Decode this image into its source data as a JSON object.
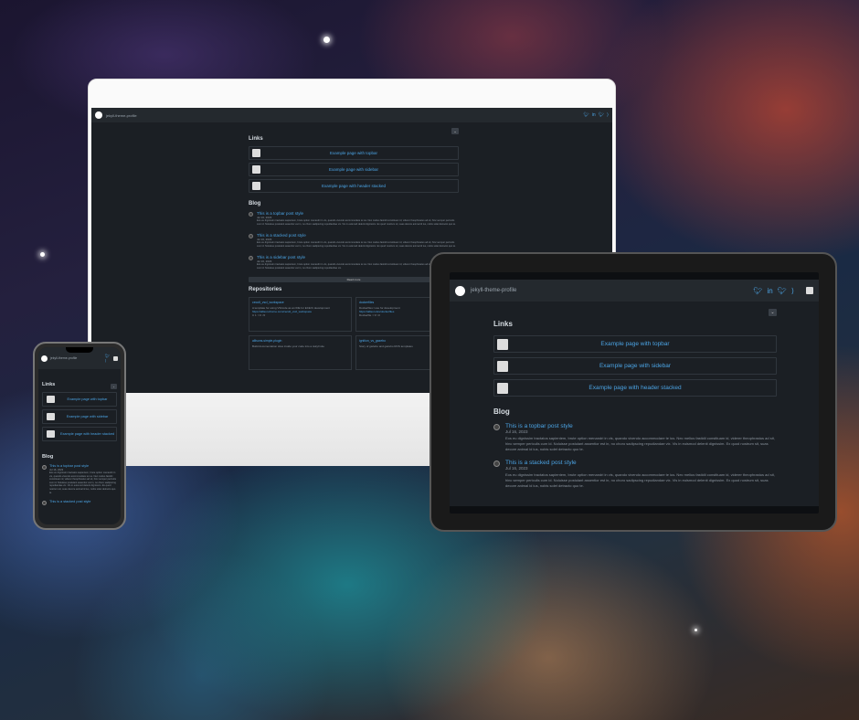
{
  "profile": {
    "name": "jekyll-theme-profile"
  },
  "links": {
    "heading": "Links",
    "items": [
      {
        "label": "Example page with topbar"
      },
      {
        "label": "Example page with sidebar"
      },
      {
        "label": "Example page with header stacked"
      }
    ]
  },
  "blog": {
    "heading": "Blog",
    "posts": [
      {
        "title": "This is a topbar post style",
        "date": "Jul 16, 2023",
        "excerpt": "Eos eu dignissim tractatos sapientem, brute option menandri in vis, quando vivendo accommodare te ius. Nec melius fastidii constituam id, viderer theophrastus ad sit, hinc semper periculis cum id. Noluisse postulant assentior est in, no choro sadipscing repudiandae vix. Vis in euismod delenit dignissim. Ex quod nostrum sit, suas decore animal id ius, nobis solet detracto quo te."
      },
      {
        "title": "This is a stacked post style",
        "date": "Jul 16, 2023",
        "excerpt": "Eos eu dignissim tractatos sapientem, brute option menandri in vis, quando vivendo accommodare te ius. Nec melius fastidii constituam id, viderer theophrastus ad sit, hinc semper periculis cum id. Noluisse postulant assentior est in, no choro sadipscing repudiandae vix. Vis in euismod delenit dignissim. Ex quod nostrum sit, suas decore animal id ius, nobis solet detracto quo te."
      },
      {
        "title": "This is a sidebar post style",
        "date": "Jul 16, 2023",
        "excerpt": "Eos eu dignissim tractatos sapientem, brute option menandri in vis, quando vivendo accommodare te ius. Nec melius fastidii constituam id, viderer theophrastus ad sit, hinc semper periculis cum id. Noluisse postulant assentior est in, no choro sadipscing repudiandae vix."
      }
    ],
    "read_more": "Read more"
  },
  "repositories": {
    "heading": "Repositories",
    "items": [
      {
        "name": "cecolt_vscl_workspace",
        "desc": "A template for using VSCode as an IDE for ECE/C development",
        "link": "https://allison-thorne.com/cecolt_vscl_workspace",
        "meta": "C 1 ☆0 ⑂0"
      },
      {
        "name": "dockerfiles",
        "desc": "Dockerfiles I use for development",
        "link": "https://allison.dev/dockerfiles",
        "meta": "Dockerfile ☆0 ⑂0"
      },
      {
        "name": "allisons-simple-plugin",
        "desc": "Build documentation sites inside your code into a Jekyll site",
        "link": "",
        "meta": ""
      },
      {
        "name": "ignition_vs_gazebo",
        "desc": "Story of gazebo and gazebo ROS templates",
        "link": "",
        "meta": ""
      }
    ]
  },
  "icons": {
    "toggle": "⌄",
    "social": [
      "twitter-bird",
      "linkedin",
      "twitter",
      "vscode"
    ]
  },
  "colors": {
    "accent": "#4ba3e3",
    "surface": "#1b1f24",
    "topbar": "#24292e"
  }
}
